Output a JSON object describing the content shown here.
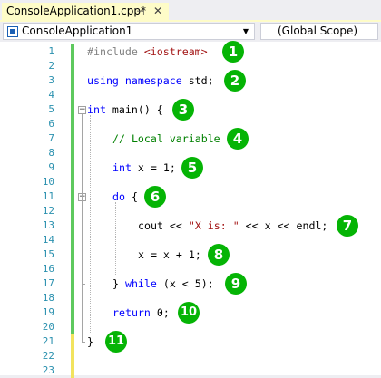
{
  "tab": {
    "title": "ConsoleApplication1.cpp*",
    "pin_glyph": "⊣",
    "close_glyph": "✕"
  },
  "navbar": {
    "project": "ConsoleApplication1",
    "scope": "(Global Scope)",
    "dropdown_glyph": "▼"
  },
  "colors": {
    "keyword": "#0000ff",
    "comment": "#008000",
    "string": "#a31515",
    "preprocessor": "#808080",
    "line_number": "#2b91af",
    "saved_change": "#5ec95e",
    "unsaved_change": "#f2e35e",
    "badge": "#05b405"
  },
  "lines": [
    {
      "n": "1",
      "change": "saved",
      "tokens": [
        {
          "t": "#include ",
          "c": "pp"
        },
        {
          "t": "<iostream>",
          "c": "st"
        }
      ],
      "indent": 0,
      "badge": "1"
    },
    {
      "n": "2",
      "change": "saved",
      "tokens": [],
      "indent": 0
    },
    {
      "n": "3",
      "change": "saved",
      "tokens": [
        {
          "t": "using",
          "c": "kw"
        },
        {
          "t": " "
        },
        {
          "t": "namespace",
          "c": "kw"
        },
        {
          "t": " std;"
        }
      ],
      "indent": 0,
      "badge": "2"
    },
    {
      "n": "4",
      "change": "saved",
      "tokens": [],
      "indent": 0
    },
    {
      "n": "5",
      "change": "saved",
      "tokens": [
        {
          "t": "int",
          "c": "kw"
        },
        {
          "t": " main() {"
        }
      ],
      "indent": 0,
      "badge": "3",
      "fold": "minus"
    },
    {
      "n": "6",
      "change": "saved",
      "tokens": [],
      "indent": 0
    },
    {
      "n": "7",
      "change": "saved",
      "tokens": [
        {
          "t": "// Local variable",
          "c": "cm"
        }
      ],
      "indent": 1,
      "badge": "4"
    },
    {
      "n": "8",
      "change": "saved",
      "tokens": [],
      "indent": 0
    },
    {
      "n": "9",
      "change": "saved",
      "tokens": [
        {
          "t": "int",
          "c": "kw"
        },
        {
          "t": " x = 1;"
        }
      ],
      "indent": 1,
      "badge": "5"
    },
    {
      "n": "10",
      "change": "saved",
      "tokens": [],
      "indent": 0
    },
    {
      "n": "11",
      "change": "saved",
      "tokens": [
        {
          "t": "do",
          "c": "kw"
        },
        {
          "t": " {"
        }
      ],
      "indent": 1,
      "badge": "6",
      "fold": "minus"
    },
    {
      "n": "12",
      "change": "saved",
      "tokens": [],
      "indent": 0
    },
    {
      "n": "13",
      "change": "saved",
      "tokens": [
        {
          "t": "cout << "
        },
        {
          "t": "\"X is: \"",
          "c": "st"
        },
        {
          "t": " << x << endl;"
        }
      ],
      "indent": 2,
      "badge": "7"
    },
    {
      "n": "14",
      "change": "saved",
      "tokens": [],
      "indent": 0
    },
    {
      "n": "15",
      "change": "saved",
      "tokens": [
        {
          "t": "x = x + 1;"
        }
      ],
      "indent": 2,
      "badge": "8"
    },
    {
      "n": "16",
      "change": "saved",
      "tokens": [],
      "indent": 0
    },
    {
      "n": "17",
      "change": "saved",
      "tokens": [
        {
          "t": "} "
        },
        {
          "t": "while",
          "c": "kw"
        },
        {
          "t": " (x < 5);"
        }
      ],
      "indent": 1,
      "badge": "9"
    },
    {
      "n": "18",
      "change": "saved",
      "tokens": [],
      "indent": 0
    },
    {
      "n": "19",
      "change": "saved",
      "tokens": [
        {
          "t": "return",
          "c": "kw"
        },
        {
          "t": " 0;"
        }
      ],
      "indent": 1,
      "badge": "10"
    },
    {
      "n": "20",
      "change": "saved",
      "tokens": [],
      "indent": 0
    },
    {
      "n": "21",
      "change": "unsaved",
      "tokens": [
        {
          "t": "}"
        }
      ],
      "indent": 0,
      "badge": "11"
    },
    {
      "n": "22",
      "change": "unsaved",
      "tokens": [],
      "indent": 0
    },
    {
      "n": "23",
      "change": "unsaved",
      "tokens": [],
      "indent": 0
    }
  ]
}
